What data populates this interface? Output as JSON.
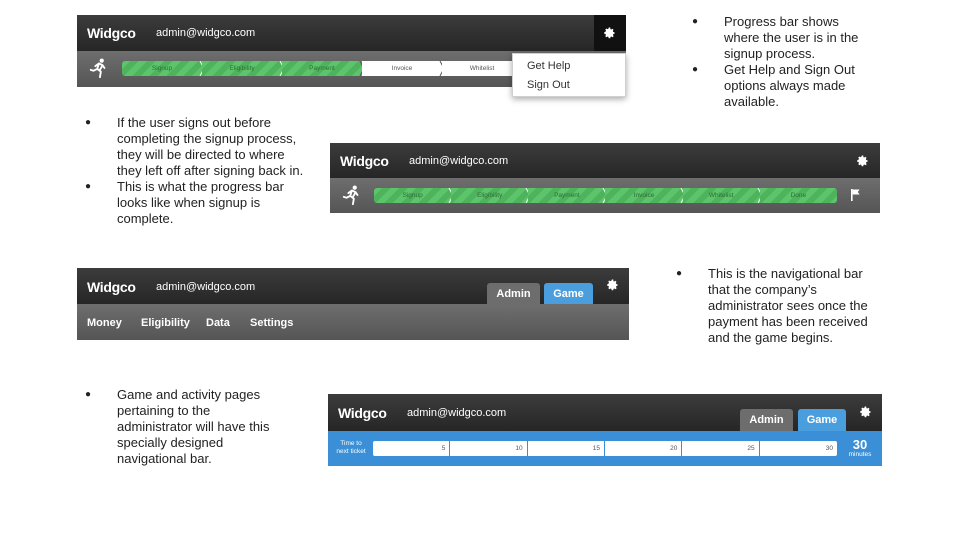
{
  "app": {
    "logo": "Widgco",
    "email": "admin@widgco.com"
  },
  "progress_partial": {
    "steps": [
      "Signup",
      "Eligibility",
      "Payment",
      "Invoice",
      "Whitelist"
    ],
    "completed": 3
  },
  "dropdown": {
    "items": [
      "Get Help",
      "Sign Out"
    ]
  },
  "progress_complete": {
    "steps": [
      "Signup",
      "Eligibility",
      "Payment",
      "Invoice",
      "Whitelist",
      "Done"
    ],
    "completed": 6
  },
  "admin_nav": {
    "links": [
      "Money",
      "Eligibility",
      "Data",
      "Settings"
    ],
    "tabs": [
      "Admin",
      "Game"
    ]
  },
  "game_bar": {
    "label_line1": "Time to",
    "label_line2": "next ticket",
    "ticks": [
      "5",
      "10",
      "15",
      "20",
      "25",
      "30"
    ],
    "value": "30",
    "unit": "minutes"
  },
  "notes": {
    "top_right": [
      "Progress bar shows where the user is in the signup process.",
      "Get Help and Sign Out options always made available."
    ],
    "left_middle": [
      "If the user signs out before completing the signup process, they will be directed to where they left off after signing back in.",
      "This is what the progress bar looks like when signup is complete."
    ],
    "right_middle": [
      "This is the navigational bar that the company’s administrator sees once the payment has been received and the game begins."
    ],
    "left_bottom": [
      "Game and activity pages pertaining to the administrator will have this specially designed navigational bar."
    ]
  },
  "colors": {
    "progress_done": "#5cc46a",
    "game_blue": "#3a8fd6",
    "tab_admin": "#6d6d6d",
    "tab_game": "#4a9ede"
  }
}
